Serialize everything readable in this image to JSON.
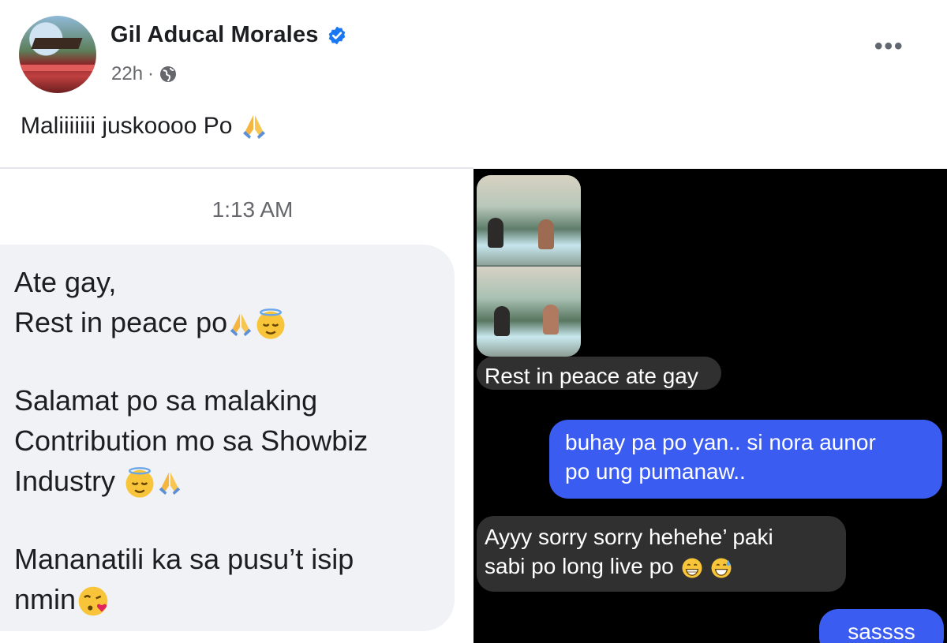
{
  "post": {
    "author_name": "Gil Aducal Morales",
    "time": "22h",
    "separator": "·",
    "caption": "Maliiiiiii juskoooo Po"
  },
  "icons": {
    "avatar": "profile-photo",
    "verified": "verified-badge-icon",
    "audience": "globe-icon",
    "more": "more-options-icon",
    "pray": "folded-hands-emoji",
    "relieved": "relieved-face-emoji",
    "kiss": "face-blowing-kiss-emoji",
    "grin": "grinning-face-emoji",
    "sweat": "grinning-sweat-emoji"
  },
  "left_screenshot": {
    "timestamp": "1:13 AM",
    "message_lines": [
      "Ate gay,",
      "Rest in peace po",
      "Salamat po sa malaking",
      "Contribution mo sa Showbiz",
      "Industry",
      "Mananatili ka sa pusu’t isip",
      "nmin"
    ]
  },
  "right_screenshot": {
    "messages": [
      {
        "direction": "incoming",
        "text": "Rest in peace ate gay"
      },
      {
        "direction": "outgoing",
        "line1": "buhay pa po yan.. si nora aunor",
        "line2": "po ung pumanaw.."
      },
      {
        "direction": "incoming",
        "line1": "Ayyy sorry sorry hehehe’ paki",
        "line2": "sabi po long live po"
      },
      {
        "direction": "outgoing",
        "text": "sassss"
      }
    ]
  },
  "colors": {
    "verified_blue": "#1877f2",
    "outgoing_bubble": "#3a5cf0",
    "incoming_bubble_dark": "#303030",
    "incoming_bubble_light": "#f0f2f5"
  }
}
